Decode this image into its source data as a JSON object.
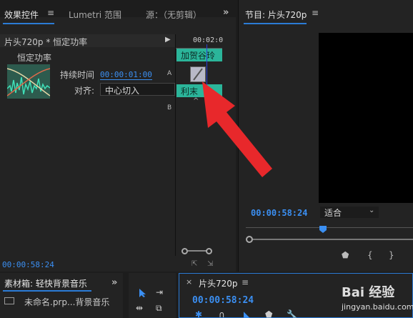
{
  "effect_controls": {
    "tabs": [
      "效果控件",
      "Lumetri 范围",
      "源：（无剪辑）"
    ],
    "menu_icon": "hamburger-icon",
    "overflow_icon": "double-chevron-right-icon",
    "sequence_label": "片头720p * 恒定功率",
    "effect_name": "恒定功率",
    "duration_label": "持续时间",
    "duration_value": "00:00:01:00",
    "align_label": "对齐:",
    "align_value": "中心切入",
    "track_a": "A",
    "track_b": "B",
    "time_ruler": "00:02:0",
    "clip_top": "加贺谷玲",
    "clip_bottom": "利末",
    "footer_time": "00:00:58:24"
  },
  "program_monitor": {
    "title": "节目: 片头720p",
    "menu_icon": "hamburger-icon",
    "time": "00:00:58:24",
    "fit_label": "适合"
  },
  "project_panel": {
    "title": "素材箱: 轻快背景音乐",
    "overflow_icon": "double-chevron-right-icon",
    "item": "未命名.prp...背景音乐"
  },
  "timeline": {
    "title": "片头720p",
    "time": "00:00:58:24"
  },
  "watermark": {
    "text": "Bai 经验",
    "url": "jingyan.baidu.com"
  },
  "colors": {
    "accent_blue": "#3b8ff2",
    "clip_green": "#2bb59a",
    "arrow_red": "#e8282b"
  }
}
